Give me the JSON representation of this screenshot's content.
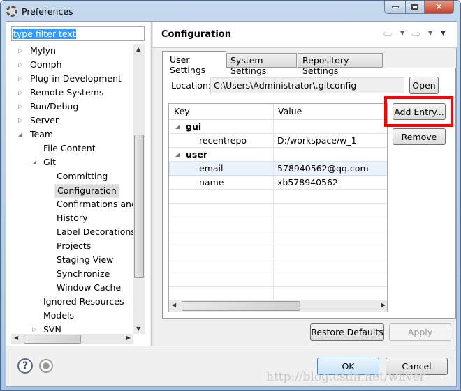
{
  "window": {
    "title": "Preferences"
  },
  "filter": {
    "value": "type filter text"
  },
  "tree": [
    {
      "label": "Mylyn",
      "level": 0,
      "expander": "collapsed"
    },
    {
      "label": "Oomph",
      "level": 0,
      "expander": "collapsed"
    },
    {
      "label": "Plug-in Development",
      "level": 0,
      "expander": "collapsed"
    },
    {
      "label": "Remote Systems",
      "level": 0,
      "expander": "collapsed"
    },
    {
      "label": "Run/Debug",
      "level": 0,
      "expander": "collapsed"
    },
    {
      "label": "Server",
      "level": 0,
      "expander": "collapsed"
    },
    {
      "label": "Team",
      "level": 0,
      "expander": "expanded"
    },
    {
      "label": "File Content",
      "level": 1,
      "expander": "none"
    },
    {
      "label": "Git",
      "level": 1,
      "expander": "expanded"
    },
    {
      "label": "Committing",
      "level": 2,
      "expander": "none"
    },
    {
      "label": "Configuration",
      "level": 2,
      "expander": "none",
      "selected": true
    },
    {
      "label": "Confirmations and W",
      "level": 2,
      "expander": "none"
    },
    {
      "label": "History",
      "level": 2,
      "expander": "none"
    },
    {
      "label": "Label Decorations",
      "level": 2,
      "expander": "none"
    },
    {
      "label": "Projects",
      "level": 2,
      "expander": "none"
    },
    {
      "label": "Staging View",
      "level": 2,
      "expander": "none"
    },
    {
      "label": "Synchronize",
      "level": 2,
      "expander": "none"
    },
    {
      "label": "Window Cache",
      "level": 2,
      "expander": "none"
    },
    {
      "label": "Ignored Resources",
      "level": 1,
      "expander": "none"
    },
    {
      "label": "Models",
      "level": 1,
      "expander": "none"
    },
    {
      "label": "SVN",
      "level": 1,
      "expander": "collapsed"
    }
  ],
  "page": {
    "title": "Configuration"
  },
  "tabs": [
    {
      "label": "User Settings",
      "active": true
    },
    {
      "label": "System Settings"
    },
    {
      "label": "Repository Settings"
    }
  ],
  "location": {
    "label": "Location:",
    "value": "C:\\Users\\Administrator\\.gitconfig",
    "open_label": "Open"
  },
  "table": {
    "headers": [
      "Key",
      "Value"
    ],
    "rows": [
      {
        "key": "gui",
        "value": "",
        "section": true
      },
      {
        "key": "recentrepo",
        "value": "D:/workspace/w_1"
      },
      {
        "key": "user",
        "value": "",
        "section": true
      },
      {
        "key": "email",
        "value": "578940562@qq.com",
        "selected": true
      },
      {
        "key": "name",
        "value": "xb578940562"
      }
    ]
  },
  "buttons": {
    "add_entry": "Add Entry...",
    "remove": "Remove",
    "restore_defaults": "Restore Defaults",
    "apply": "Apply",
    "ok": "OK",
    "cancel": "Cancel"
  },
  "highlight_color": "#ff0000",
  "watermark": "http://blog.csdn.net/wilver"
}
